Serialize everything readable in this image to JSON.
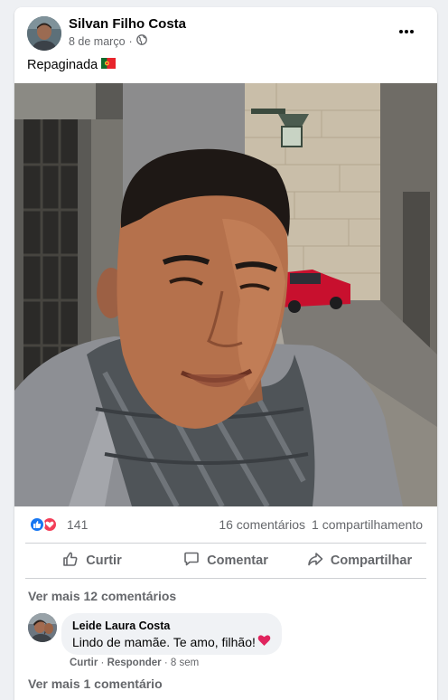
{
  "post": {
    "author": "Silvan Filho Costa",
    "date": "8 de março",
    "separator": "·",
    "privacy_icon": "globe-icon",
    "caption": "Repaginada",
    "caption_emoji": "portugal-flag",
    "more_icon": "ellipsis-icon"
  },
  "reactions": {
    "icons": [
      "like-reaction-icon",
      "love-reaction-icon"
    ],
    "count": "141",
    "comments": "16 comentários",
    "shares": "1 compartilhamento"
  },
  "actions": [
    {
      "label": "Curtir",
      "icon": "thumbs-up-icon"
    },
    {
      "label": "Comentar",
      "icon": "comment-icon"
    },
    {
      "label": "Compartilhar",
      "icon": "share-icon"
    }
  ],
  "comments": {
    "view_more_top": "Ver mais 12 comentários",
    "items": [
      {
        "author": "Leide Laura Costa",
        "text": "Lindo de mamãe. Te amo, filhão!",
        "emoji": "heart",
        "like_label": "Curtir",
        "reply_label": "Responder",
        "time": "8 sem"
      }
    ],
    "view_more_bottom": "Ver mais 1 comentário"
  },
  "colors": {
    "like_blue": "#1877f2",
    "love_red": "#f33e58",
    "secondary_text": "#65676b",
    "bubble_bg": "#f0f2f5"
  }
}
